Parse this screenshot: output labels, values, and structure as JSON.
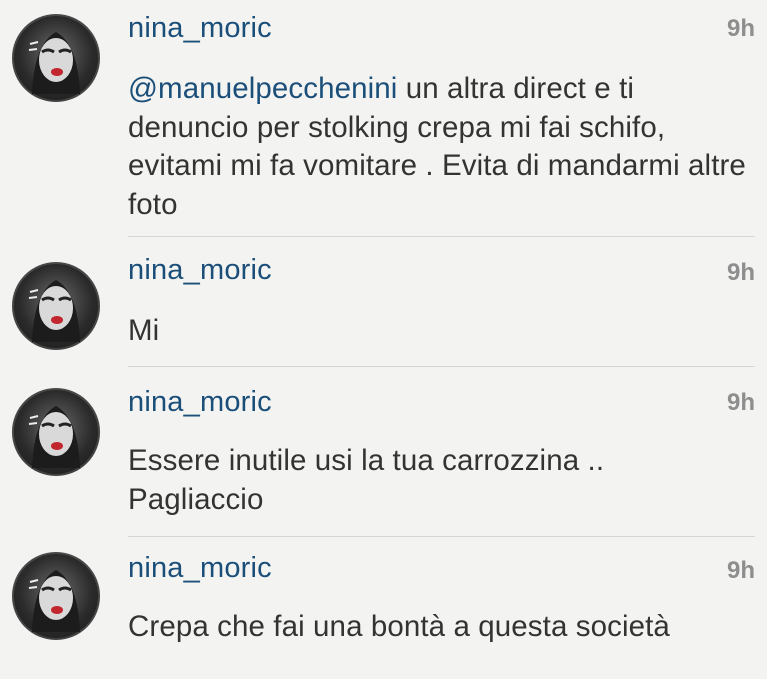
{
  "comments": [
    {
      "username": "nina_moric",
      "time": "9h",
      "mention": "@manuelpecchenini",
      "text": " un altra direct e ti denuncio per stolking crepa mi fai schifo, evitami mi fa vomitare . Evita di mandarmi altre foto"
    },
    {
      "username": "nina_moric",
      "time": "9h",
      "text": "Mi"
    },
    {
      "username": "nina_moric",
      "time": "9h",
      "text": "Essere inutile usi la tua carrozzina .. Pagliaccio"
    },
    {
      "username": "nina_moric",
      "time": "9h",
      "text": "Crepa che fai una bontà a questa società"
    }
  ]
}
